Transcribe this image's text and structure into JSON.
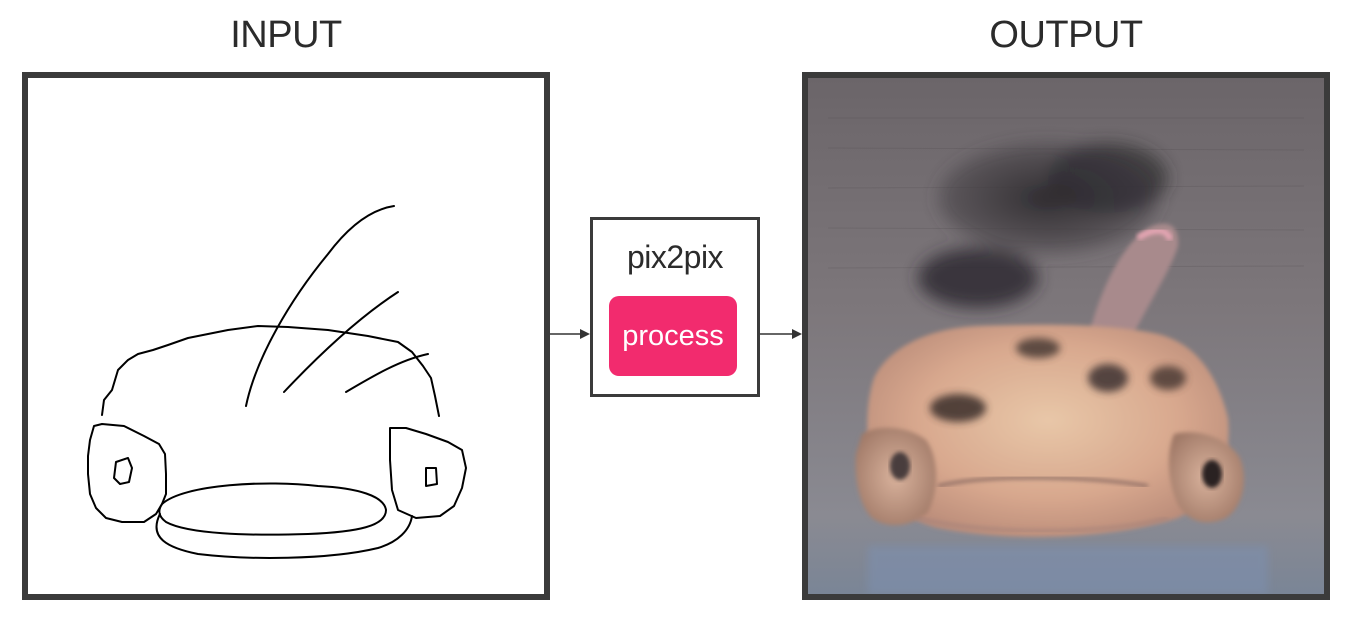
{
  "input_panel": {
    "title": "INPUT"
  },
  "output_panel": {
    "title": "OUTPUT"
  },
  "processor": {
    "model_name": "pix2pix",
    "button_label": "process",
    "button_color": "#f22b6e"
  },
  "colors": {
    "frame_border": "#3b3b3b",
    "sketch_stroke": "#000000",
    "background": "#ffffff"
  }
}
